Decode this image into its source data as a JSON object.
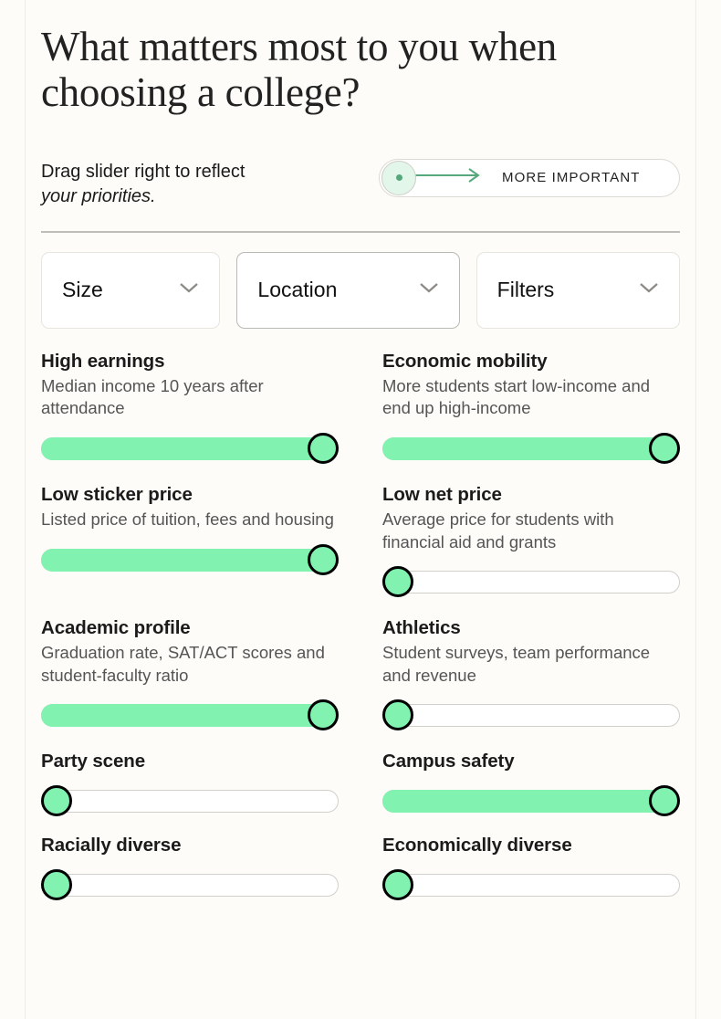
{
  "headline": "What matters most to you when choosing a college?",
  "instruction": {
    "line1": "Drag slider right to reflect",
    "line2": "your priorities."
  },
  "legend": {
    "label": "MORE IMPORTANT",
    "knob_dot_color": "#56A87C",
    "arrow_color": "#56A87C"
  },
  "dropdowns": [
    {
      "label": "Size"
    },
    {
      "label": "Location"
    },
    {
      "label": "Filters"
    }
  ],
  "colors": {
    "background": "#FDFCF9",
    "slider_fill": "#82F2B1",
    "slider_track": "#FFFFFF",
    "slider_border": "#D2D0CA",
    "thumb_border": "#000000"
  },
  "sliders": [
    {
      "title": "High earnings",
      "desc": "Median income 10 years after attendance",
      "value": 100
    },
    {
      "title": "Economic mobility",
      "desc": "More students start low-income and end up high-income",
      "value": 100
    },
    {
      "title": "Low sticker price",
      "desc": "Listed price of tuition, fees and housing",
      "value": 100
    },
    {
      "title": "Low net price",
      "desc": "Average price for students with financial aid and grants",
      "value": 0
    },
    {
      "title": "Academic profile",
      "desc": "Graduation rate, SAT/ACT scores and student-faculty ratio",
      "value": 100
    },
    {
      "title": "Athletics",
      "desc": "Student surveys, team performance and revenue",
      "value": 0
    },
    {
      "title": "Party scene",
      "desc": "",
      "value": 0
    },
    {
      "title": "Campus safety",
      "desc": "",
      "value": 100
    },
    {
      "title": "Racially diverse",
      "desc": "",
      "value": 0
    },
    {
      "title": "Economically diverse",
      "desc": "",
      "value": 0
    }
  ]
}
